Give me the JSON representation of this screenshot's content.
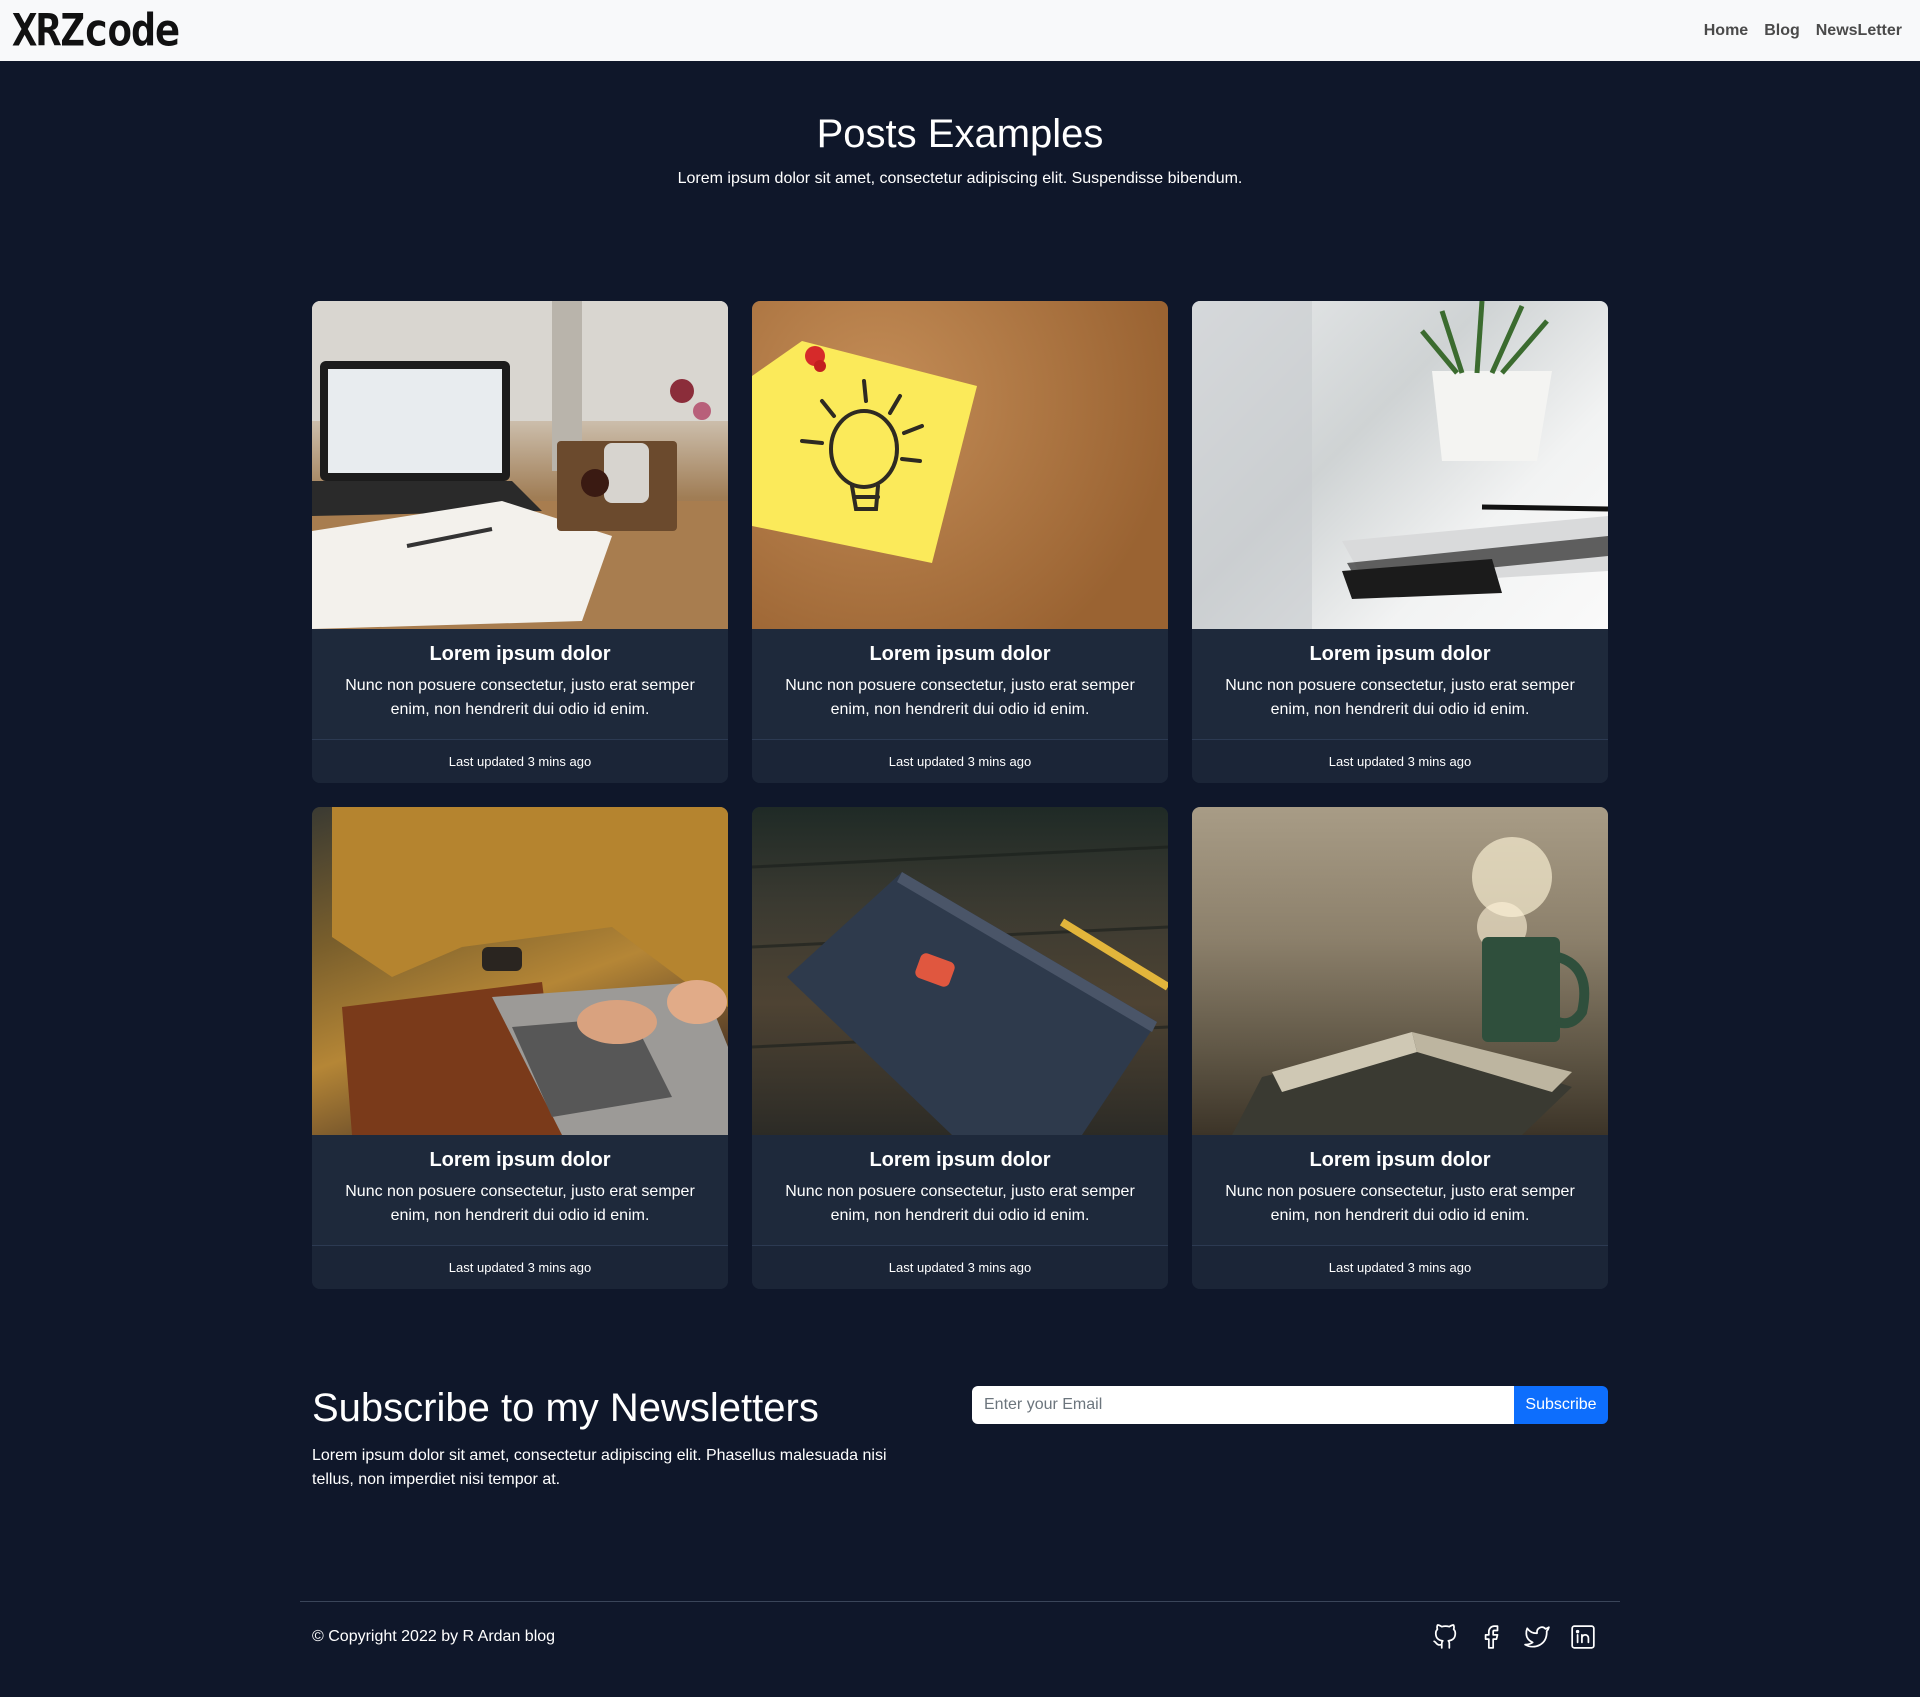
{
  "nav": {
    "brand": "XRZcode",
    "links": [
      "Home",
      "Blog",
      "NewsLetter"
    ]
  },
  "hero": {
    "title": "Posts Examples",
    "subtitle": "Lorem ipsum dolor sit amet, consectetur adipiscing elit. Suspendisse bibendum."
  },
  "cards": [
    {
      "title": "Lorem ipsum dolor",
      "text": "Nunc non posuere consectetur, justo erat semper enim, non hendrerit dui odio id enim.",
      "footer": "Last updated 3 mins ago",
      "image": "laptop-desk-photo"
    },
    {
      "title": "Lorem ipsum dolor",
      "text": "Nunc non posuere consectetur, justo erat semper enim, non hendrerit dui odio id enim.",
      "footer": "Last updated 3 mins ago",
      "image": "lightbulb-sticky-note-photo"
    },
    {
      "title": "Lorem ipsum dolor",
      "text": "Nunc non posuere consectetur, justo erat semper enim, non hendrerit dui odio id enim.",
      "footer": "Last updated 3 mins ago",
      "image": "plant-notebook-phone-photo"
    },
    {
      "title": "Lorem ipsum dolor",
      "text": "Nunc non posuere consectetur, justo erat semper enim, non hendrerit dui odio id enim.",
      "footer": "Last updated 3 mins ago",
      "image": "person-typing-laptop-photo"
    },
    {
      "title": "Lorem ipsum dolor",
      "text": "Nunc non posuere consectetur, justo erat semper enim, non hendrerit dui odio id enim.",
      "footer": "Last updated 3 mins ago",
      "image": "write-ideas-notebook-photo"
    },
    {
      "title": "Lorem ipsum dolor",
      "text": "Nunc non posuere consectetur, justo erat semper enim, non hendrerit dui odio id enim.",
      "footer": "Last updated 3 mins ago",
      "image": "mug-open-book-photo"
    }
  ],
  "newsletter": {
    "title": "Subscribe to my Newsletters",
    "text": "Lorem ipsum dolor sit amet, consectetur adipiscing elit. Phasellus malesuada nisi tellus, non imperdiet nisi tempor at.",
    "placeholder": "Enter your Email",
    "button": "Subscribe",
    "button_color": "#0d6efd"
  },
  "footer": {
    "copyright": "© Copyright 2022 by R Ardan blog",
    "socials": [
      "github-icon",
      "facebook-icon",
      "twitter-icon",
      "linkedin-icon"
    ]
  },
  "colors": {
    "background": "#0f172a",
    "card": "#1e293b",
    "navbar": "#f8f9fa"
  }
}
